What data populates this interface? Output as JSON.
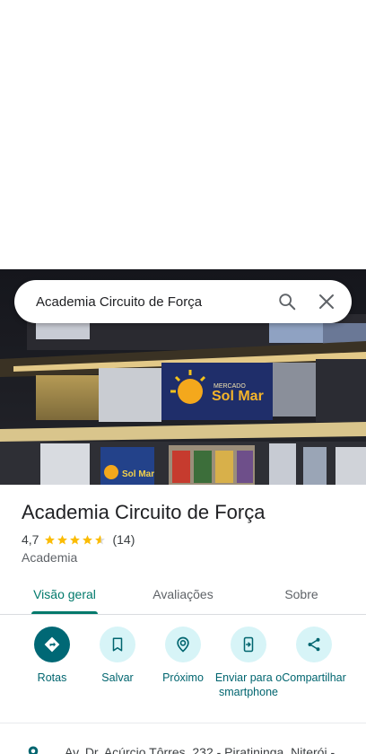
{
  "search": {
    "query": "Academia Circuito de Força",
    "search_icon": "search-icon",
    "close_icon": "close-icon"
  },
  "hero": {
    "photo_sign_small": "MERCADO",
    "photo_sign_main": "Sol Mar",
    "photo_sign_lower": "Sol Mar"
  },
  "place": {
    "name": "Academia Circuito de Força",
    "rating": "4,7",
    "rating_value": 4.7,
    "reviews": "(14)",
    "category": "Academia"
  },
  "tabs": [
    {
      "label": "Visão geral",
      "active": true
    },
    {
      "label": "Avaliações",
      "active": false
    },
    {
      "label": "Sobre",
      "active": false
    }
  ],
  "actions": [
    {
      "label": "Rotas",
      "icon": "directions-icon"
    },
    {
      "label": "Salvar",
      "icon": "bookmark-icon"
    },
    {
      "label": "Próximo",
      "icon": "nearby-icon"
    },
    {
      "label": "Enviar para o smartphone",
      "icon": "send-to-phone-icon"
    },
    {
      "label": "Compartilhar",
      "icon": "share-icon"
    }
  ],
  "address": {
    "text": "Av. Dr. Acúrcio Tôrres, 232 - Piratininga, Niterói -",
    "icon": "location-pin-icon"
  },
  "colors": {
    "accent": "#00796b",
    "action_bg": "#d7f4f7",
    "primary_action_bg": "#006875",
    "star": "#fbbc04"
  }
}
